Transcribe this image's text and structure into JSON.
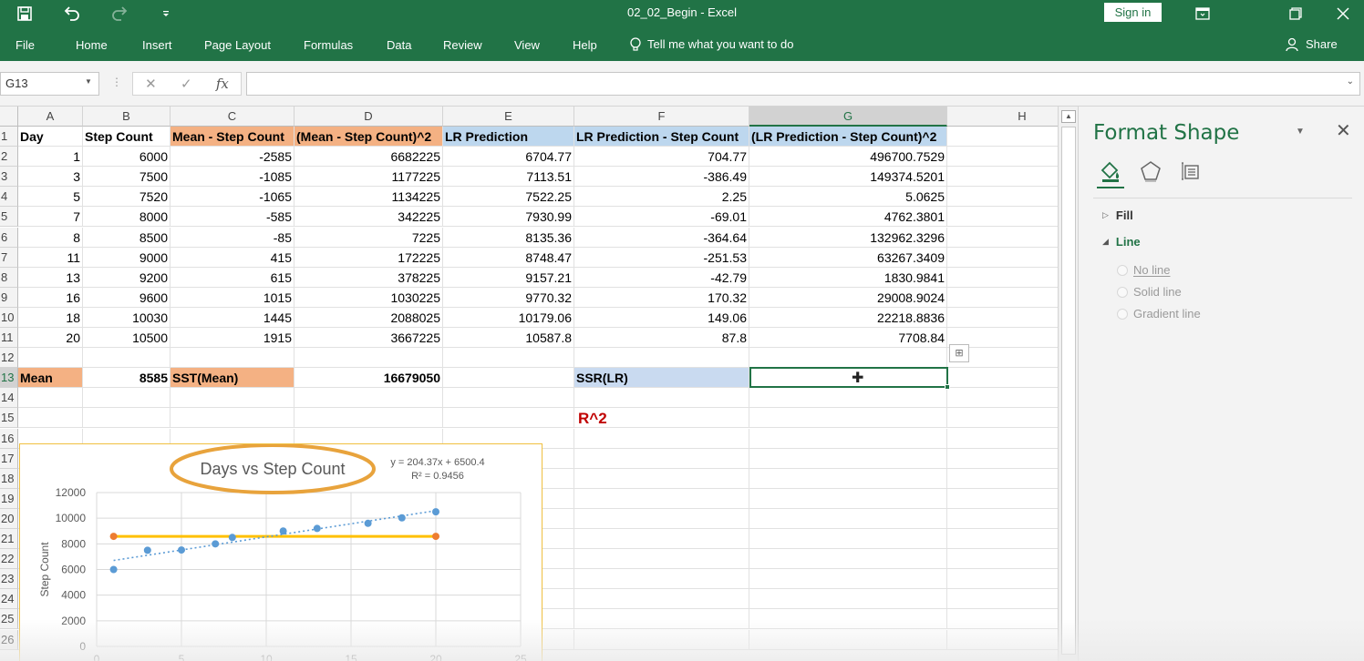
{
  "titlebar": {
    "title": "02_02_Begin  -  Excel",
    "sign_in": "Sign in",
    "icons": [
      "save-icon",
      "undo-icon",
      "redo-icon",
      "customize-qat-icon",
      "ribbon-display-icon",
      "restore-icon",
      "close-icon"
    ]
  },
  "menu": {
    "items": [
      "File",
      "Home",
      "Insert",
      "Page Layout",
      "Formulas",
      "Data",
      "Review",
      "View",
      "Help"
    ],
    "tell_me": "Tell me what you want to do",
    "share": "Share"
  },
  "formula_bar": {
    "name_box": "G13",
    "fx": "fx",
    "value": ""
  },
  "columns": [
    "A",
    "B",
    "C",
    "D",
    "E",
    "F",
    "G",
    "H"
  ],
  "selected_column": "G",
  "selected_row": "13",
  "rows": [
    {
      "num": "1",
      "cells": [
        "Day",
        "Step Count",
        "Mean - Step Count",
        "(Mean - Step Count)^2",
        "LR Prediction",
        "LR Prediction - Step Count",
        "(LR Prediction - Step Count)^2",
        ""
      ]
    },
    {
      "num": "2",
      "cells": [
        "1",
        "6000",
        "-2585",
        "6682225",
        "6704.77",
        "704.77",
        "496700.7529",
        ""
      ]
    },
    {
      "num": "3",
      "cells": [
        "3",
        "7500",
        "-1085",
        "1177225",
        "7113.51",
        "-386.49",
        "149374.5201",
        ""
      ]
    },
    {
      "num": "4",
      "cells": [
        "5",
        "7520",
        "-1065",
        "1134225",
        "7522.25",
        "2.25",
        "5.0625",
        ""
      ]
    },
    {
      "num": "5",
      "cells": [
        "7",
        "8000",
        "-585",
        "342225",
        "7930.99",
        "-69.01",
        "4762.3801",
        ""
      ]
    },
    {
      "num": "6",
      "cells": [
        "8",
        "8500",
        "-85",
        "7225",
        "8135.36",
        "-364.64",
        "132962.3296",
        ""
      ]
    },
    {
      "num": "7",
      "cells": [
        "11",
        "9000",
        "415",
        "172225",
        "8748.47",
        "-251.53",
        "63267.3409",
        ""
      ]
    },
    {
      "num": "8",
      "cells": [
        "13",
        "9200",
        "615",
        "378225",
        "9157.21",
        "-42.79",
        "1830.9841",
        ""
      ]
    },
    {
      "num": "9",
      "cells": [
        "16",
        "9600",
        "1015",
        "1030225",
        "9770.32",
        "170.32",
        "29008.9024",
        ""
      ]
    },
    {
      "num": "10",
      "cells": [
        "18",
        "10030",
        "1445",
        "2088025",
        "10179.06",
        "149.06",
        "22218.8836",
        ""
      ]
    },
    {
      "num": "11",
      "cells": [
        "20",
        "10500",
        "1915",
        "3667225",
        "10587.8",
        "87.8",
        "7708.84",
        ""
      ]
    },
    {
      "num": "12",
      "cells": [
        "",
        "",
        "",
        "",
        "",
        "",
        "",
        ""
      ]
    },
    {
      "num": "13",
      "cells": [
        "Mean",
        "8585",
        "SST(Mean)",
        "16679050",
        "",
        "SSR(LR)",
        "",
        ""
      ]
    },
    {
      "num": "14",
      "cells": [
        "",
        "",
        "",
        "",
        "",
        "",
        "",
        ""
      ]
    },
    {
      "num": "15",
      "cells": [
        "",
        "",
        "",
        "",
        "",
        "R^2",
        "",
        ""
      ]
    },
    {
      "num": "16",
      "cells": []
    },
    {
      "num": "17",
      "cells": []
    },
    {
      "num": "18",
      "cells": []
    },
    {
      "num": "19",
      "cells": []
    },
    {
      "num": "20",
      "cells": []
    },
    {
      "num": "21",
      "cells": []
    },
    {
      "num": "22",
      "cells": []
    },
    {
      "num": "23",
      "cells": []
    },
    {
      "num": "24",
      "cells": []
    },
    {
      "num": "25",
      "cells": []
    },
    {
      "num": "26",
      "cells": []
    }
  ],
  "chart_data": {
    "type": "scatter",
    "title": "Days vs Step Count",
    "ylabel": "Step Count",
    "xlabel": "",
    "ylim": [
      0,
      12000
    ],
    "xlim": [
      0,
      25
    ],
    "yticks": [
      "0",
      "2000",
      "4000",
      "6000",
      "8000",
      "10000",
      "12000"
    ],
    "xticks": [
      "0",
      "5",
      "10",
      "15",
      "20",
      "25"
    ],
    "trend_equation": "y = 204.37x + 6500.4",
    "r_squared": "R² = 0.9456",
    "series": [
      {
        "x": [
          1,
          3,
          5,
          7,
          8,
          11,
          13,
          16,
          18,
          20
        ],
        "values": [
          6000,
          7500,
          7520,
          8000,
          8500,
          9000,
          9200,
          9600,
          10030,
          10500
        ],
        "color": "#5b9bd5"
      },
      {
        "x": [
          1,
          20
        ],
        "values": [
          8585,
          8585
        ],
        "color": "#ed7d31"
      }
    ],
    "trendline": {
      "slope": 204.37,
      "intercept": 6500.4,
      "color": "#5b9bd5"
    },
    "mean_line_color": "#ffc000",
    "title_highlight_color": "#e8a33c",
    "grid": true
  },
  "pane": {
    "title": "Format Shape",
    "tabs": [
      "fill-line-icon",
      "effects-icon",
      "size-properties-icon"
    ],
    "sections": [
      {
        "label": "Fill",
        "open": false
      },
      {
        "label": "Line",
        "open": true
      }
    ],
    "line_options": [
      "No line",
      "Solid line",
      "Gradient line"
    ]
  }
}
